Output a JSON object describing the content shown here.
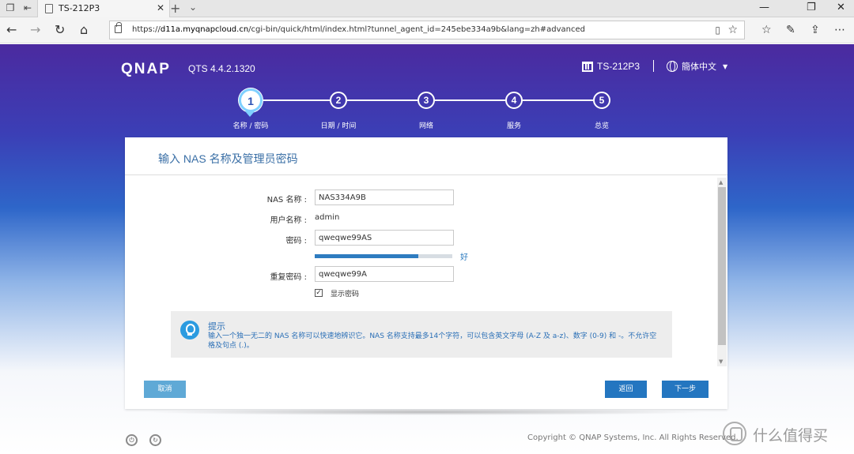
{
  "browser": {
    "tab_title": "TS-212P3",
    "url_prefix": "https://",
    "url_domain": "d11a.myqnapcloud.cn",
    "url_path": "/cgi-bin/quick/html/index.html?tunnel_agent_id=245ebe334a9b&lang=zh#advanced",
    "icons": [
      "back-icon",
      "forward-icon",
      "refresh-icon",
      "home-icon",
      "lock-icon",
      "reading-view-icon",
      "favorite-star-icon",
      "favorites-icon",
      "pen-icon",
      "share-icon",
      "more-icon"
    ]
  },
  "header": {
    "logo": "QNAP",
    "version": "QTS 4.4.2.1320",
    "device_name": "TS-212P3",
    "language": "簡体中文"
  },
  "steps": [
    {
      "number": "1",
      "label": "名称 / 密码",
      "active": true
    },
    {
      "number": "2",
      "label": "日期 / 时间",
      "active": false
    },
    {
      "number": "3",
      "label": "网络",
      "active": false
    },
    {
      "number": "4",
      "label": "服务",
      "active": false
    },
    {
      "number": "5",
      "label": "总览",
      "active": false
    }
  ],
  "panel": {
    "title": "输入 NAS 名称及管理员密码",
    "form": {
      "nas_name_label": "NAS 名称 :",
      "nas_name_value": "NAS334A9B",
      "username_label": "用户名称 :",
      "username_value": "admin",
      "password_label": "密码 :",
      "password_value": "qweqwe99AS",
      "strength_fraction": 0.75,
      "strength_text": "好",
      "confirm_label": "重复密码 :",
      "confirm_value": "qweqwe99A",
      "show_password_checked": true,
      "show_password_label": "显示密码"
    },
    "hint": {
      "title": "提示",
      "text": "输入一个独一无二的 NAS 名称可以快速地辨识它。NAS 名称支持最多14个字符，可以包含英文字母 (A-Z 及 a-z)、数字 (0-9) 和 -。不允许空格及句点 (.)。"
    },
    "buttons": {
      "cancel": "取消",
      "back": "返回",
      "next": "下一步"
    }
  },
  "footer": {
    "copyright": "Copyright © QNAP Systems, Inc. All Rights Reserved.",
    "watermark": "什么值得买"
  },
  "colors": {
    "accent": "#2476c0",
    "cancel": "#5fa9d6",
    "hint_text": "#2a6fb6"
  }
}
